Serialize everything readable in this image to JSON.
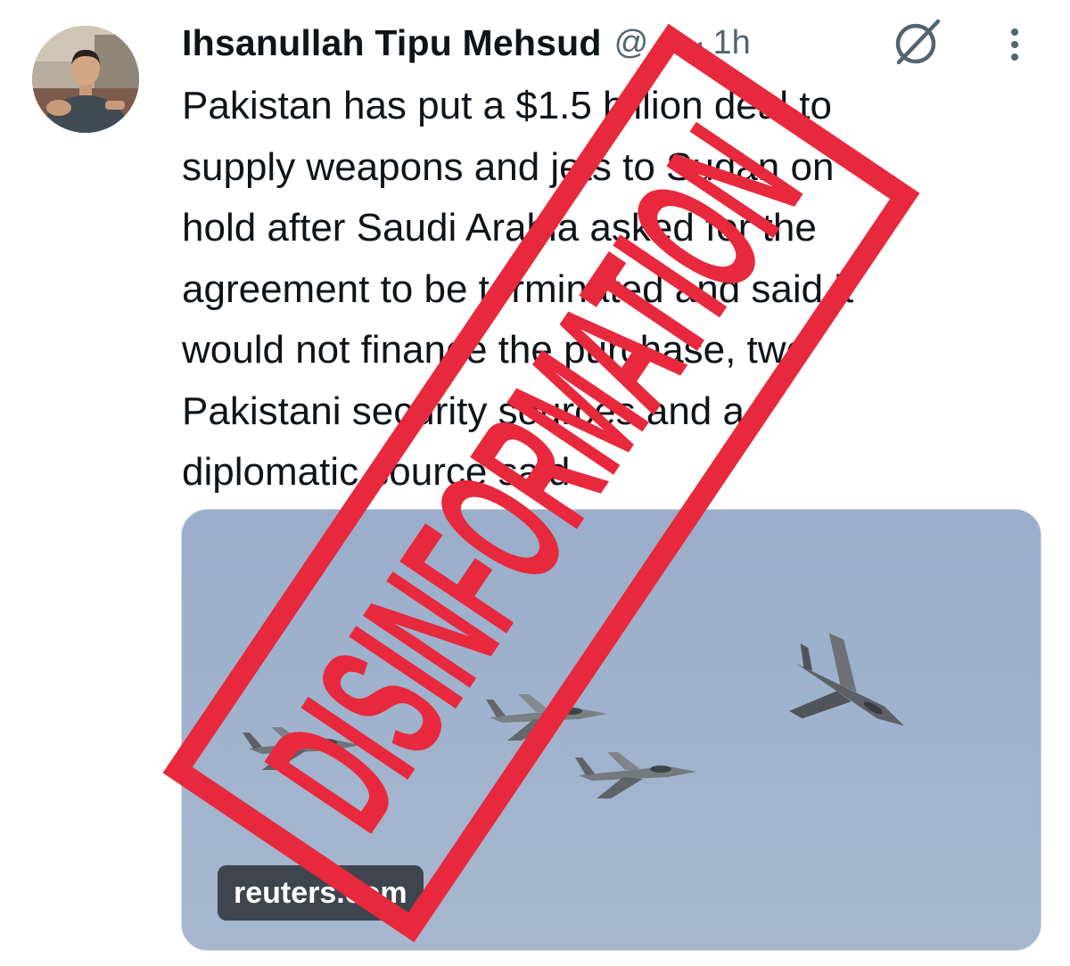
{
  "tweet": {
    "author": {
      "display_name": "Ihsanullah Tipu Mehsud",
      "handle": "@...",
      "avatar_icon": "user-avatar"
    },
    "separator": "·",
    "timestamp": "1h",
    "grok_icon": "grok-icon",
    "more_icon": "more-vertical-icon",
    "text_lines": [
      "Pakistan has put a $1.5 billion deal to",
      "supply weapons and jets to Sudan on",
      "hold after Saudi Arabia asked for the",
      "agreement to be terminated and said it",
      "would not finance the purchase, two",
      "Pakistani security sources and a",
      "diplomatic source said."
    ],
    "media": {
      "source_label": "reuters.com",
      "description_icon": "fighter-jets-photo"
    }
  },
  "stamp": {
    "text": "DISINFORMATION",
    "color": "#e8283c"
  },
  "colors": {
    "text_primary": "#0f1419",
    "text_secondary": "#536471",
    "sky": "#9eb2cc"
  }
}
